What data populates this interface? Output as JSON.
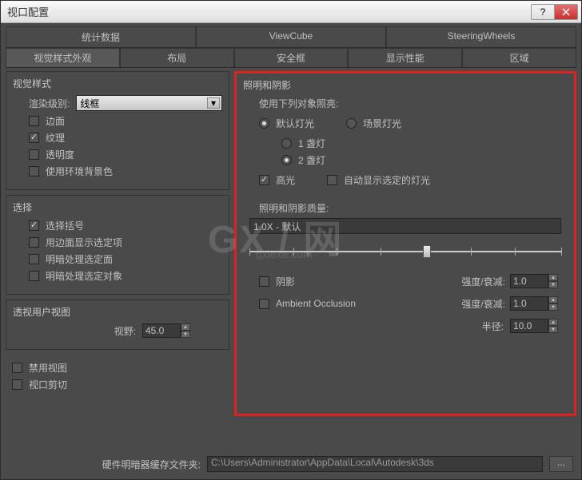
{
  "window": {
    "title": "视口配置"
  },
  "tabs_primary": [
    "统计数据",
    "ViewCube",
    "SteeringWheels"
  ],
  "tabs_secondary": [
    "视觉样式外观",
    "布局",
    "安全框",
    "显示性能",
    "区域"
  ],
  "visual_style": {
    "title": "视觉样式",
    "render_level_label": "渲染级别:",
    "render_level_value": "线框",
    "edge_face": "边面",
    "texture": "纹理",
    "transparency": "透明度",
    "use_env_bg": "使用环境背景色"
  },
  "selection": {
    "title": "选择",
    "sel_bracket": "选择括号",
    "edge_sel_display": "用边面显示选定项",
    "shade_sel_face": "明暗处理选定面",
    "shade_sel_obj": "明暗处理选定对象"
  },
  "persp": {
    "title": "透视用户视图",
    "fov_label": "视野:",
    "fov_value": "45.0"
  },
  "bottom_checks": {
    "disable_view": "禁用视图",
    "viewport_clip": "视口剪切"
  },
  "lighting": {
    "title": "照明和阴影",
    "use_obj_label": "使用下列对象照亮:",
    "default_light": "默认灯光",
    "scene_light": "场景灯光",
    "one_light": "1 盏灯",
    "two_light": "2 盏灯",
    "highlight": "高光",
    "auto_show_sel_lights": "自动显示选定的灯光",
    "quality_label": "照明和阴影质量:",
    "quality_value": "1.0X - 默认",
    "shadow": "阴影",
    "ao": "Ambient Occlusion",
    "intensity_label": "强度/衰减:",
    "intensity1": "1.0",
    "intensity2": "1.0",
    "radius_label": "半径:",
    "radius_value": "10.0"
  },
  "footer": {
    "label": "硬件明暗器缓存文件夹:",
    "path": "C:\\Users\\Administrator\\AppData\\Local\\Autodesk\\3ds",
    "browse": "..."
  }
}
